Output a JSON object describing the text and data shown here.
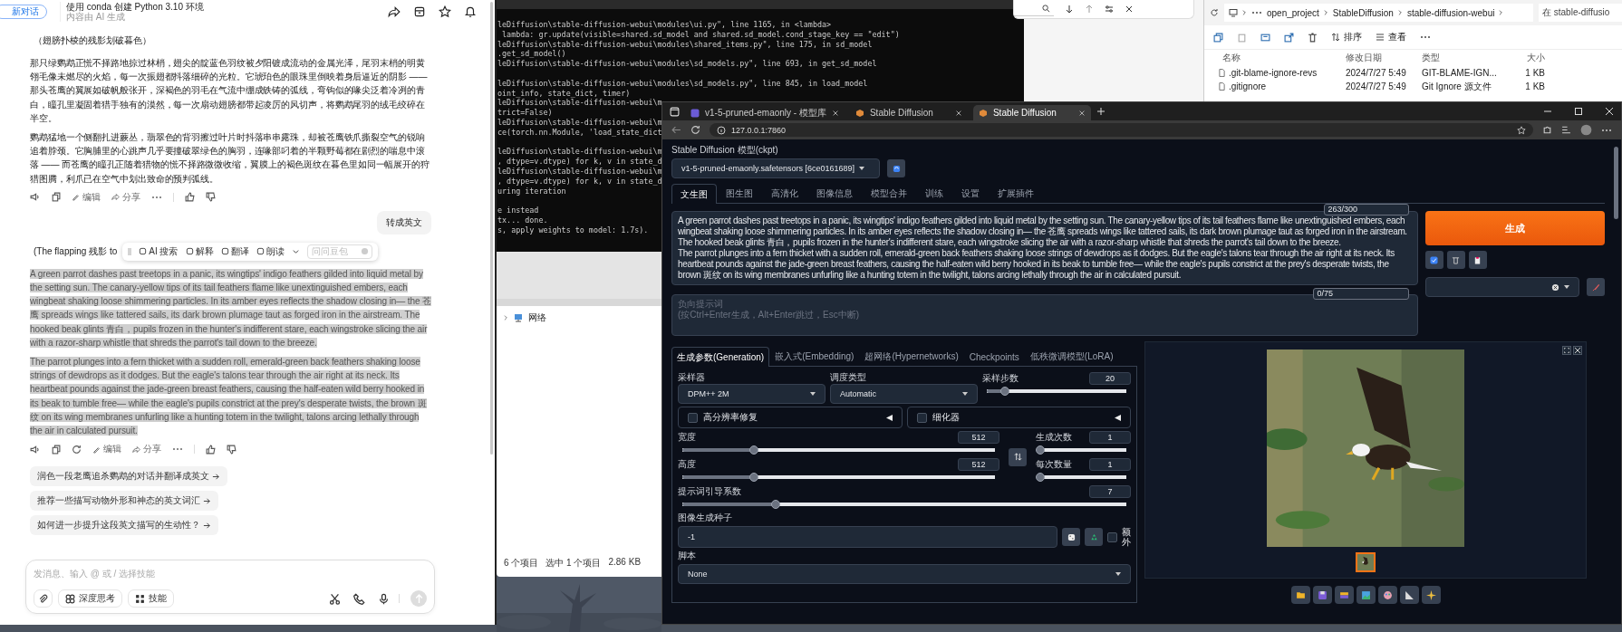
{
  "chat_window": {
    "new_chat_button": "新对话",
    "title": "使用 conda 创建 Python 3.10 环境",
    "subtitle": "内容由 AI 生成",
    "messages": [
      {
        "kind": "assistant",
        "heading": "（翅膀扑棱的残影划破暮色）",
        "text_selected": false,
        "regenerate": false,
        "paragraphs": [
          "那只绿鹦鹉正慌不择路地掠过林梢，翅尖的靛蓝色羽纹被夕阳镀成流动的金属光泽，尾羽末梢的明黄翎毛像未燃尽的火焰，每一次振翅都抖落细碎的光粒。它琥珀色的眼珠里倒映着身后逼近的阴影 —— 那头苍鹰的翼展如破帆般张开，深褐色的羽毛在气流中绷成铁铸的弧线，弯钩似的喙尖泛着冷冽的青白，瞳孔里凝固着猎手独有的漠然，每一次扇动翅膀都带起凌厉的风切声，将鹦鹉尾羽的绒毛绞碎在半空。",
          "鹦鹉猛地一个侧翻扎进蕨丛，翡翠色的背羽擦过叶片时抖落串串露珠，却被苍鹰铁爪撕裂空气的锐响追着脖颈。它胸脯里的心跳声几乎要撞破翠绿色的胸羽，连喙部叼着的半颗野莓都在剧烈的喘息中滚落 —— 而苍鹰的瞳孔正随着猎物的慌不择路微微收缩，翼膜上的褐色斑纹在暮色里如同一幅展开的狩猎图腾，利爪已在空气中划出致命的预判弧线。"
        ],
        "actions": [
          "编辑",
          "分享"
        ]
      },
      {
        "kind": "user",
        "text": "转成英文"
      },
      {
        "kind": "assistant",
        "heading": "(The flapping 残影 to",
        "text_selected": true,
        "regenerate": true,
        "selection_toolbar": {
          "actions": [
            "AI 搜索",
            "解释",
            "翻译",
            "朗读"
          ],
          "ask_placeholder": "问问豆包"
        },
        "paragraphs": [
          "A green parrot dashes past treetops in a panic, its wingtips' indigo feathers gilded into liquid metal by the setting sun. The canary-yellow tips of its tail feathers flame like unextinguished embers, each wingbeat shaking loose shimmering particles. In its amber eyes reflects the shadow closing in— the 苍鹰 spreads wings like tattered sails, its dark brown plumage taut as forged iron in the airstream. The hooked beak glints 青白，pupils frozen in the hunter's indifferent stare, each wingstroke slicing the air with a razor-sharp whistle that shreds the parrot's tail down to the breeze.",
          "The parrot plunges into a fern thicket with a sudden roll, emerald-green back feathers shaking loose strings of dewdrops as it dodges. But the eagle's talons tear through the air right at its neck. Its heartbeat pounds against the jade-green breast feathers, causing the half-eaten wild berry hooked in its beak to tumble free— while the eagle's pupils constrict at the prey's desperate twists, the brown 斑纹 on its wing membranes unfurling like a hunting totem in the twilight, talons arcing lethally through the air in calculated pursuit."
        ],
        "actions": [
          "编辑",
          "分享"
        ]
      }
    ],
    "suggestions": [
      "润色一段老鹰追杀鹦鹉的对话并翻译成英文",
      "推荐一些描写动物外形和神态的英文词汇",
      "如何进一步提升这段英文描写的生动性？"
    ],
    "composer": {
      "placeholder": "发消息、输入 @ 或 / 选择技能",
      "buttons": [
        "深度思考",
        "技能"
      ]
    }
  },
  "terminal": {
    "blocks": [
      {
        "lines": [
          "leDiffusion\\stable-diffusion-webui\\modules\\ui.py\", line 1165, in <lambda>",
          " lambda: gr.update(visible=shared.sd_model and shared.sd_model.cond_stage_key == \"edit\")",
          "leDiffusion\\stable-diffusion-webui\\modules\\shared_items.py\", line 175, in sd_model",
          ".get_sd_model()",
          "leDiffusion\\stable-diffusion-webui\\modules\\sd_models.py\", line 693, in get_sd_model"
        ]
      },
      {
        "lines": [
          "leDiffusion\\stable-diffusion-webui\\modules\\sd_models.py\", line 845, in load_model",
          "oint_info, state_dict, timer)",
          "leDiffusion\\stable-diffusion-webui\\m",
          "trict=False)",
          "leDiffusion\\stable-diffusion-webui\\m",
          "ce(torch.nn.Module, 'load_state_dict"
        ]
      },
      {
        "lines": [
          "leDiffusion\\stable-diffusion-webui\\m",
          ", dtype=v.dtype) for k, v in state_d",
          "leDiffusion\\stable-diffusion-webui\\m",
          ", dtype=v.dtype) for k, v in state_d",
          "uring iteration"
        ]
      },
      {
        "lines": [
          "e instead",
          "tx... done.",
          "s, apply weights to model: 1.7s)."
        ]
      }
    ]
  },
  "explorer": {
    "breadcrumb": [
      "open_project",
      "StableDiffusion",
      "stable-diffusion-webui"
    ],
    "search_placeholder": "在 stable-diffusio",
    "toolbar": [
      "排序",
      "查看"
    ],
    "columns": [
      "名称",
      "修改日期",
      "类型",
      "大小"
    ],
    "rows": [
      [
        ".git-blame-ignore-revs",
        "2024/7/27 5:49",
        "GIT-BLAME-IGN...",
        "1 KB"
      ],
      [
        ".gitignore",
        "2024/7/27 5:49",
        "Git Ignore 源文件",
        "1 KB"
      ]
    ]
  },
  "explorer_pane": {
    "nav_items": [
      "网络"
    ],
    "status": [
      "6 个项目",
      "选中 1 个项目",
      "2.86 KB"
    ]
  },
  "browser": {
    "tabs": [
      {
        "title": "v1-5-pruned-emaonly - 模型库",
        "selected": false
      },
      {
        "title": "Stable Diffusion",
        "selected": false
      },
      {
        "title": "Stable Diffusion",
        "selected": true
      }
    ],
    "url": "127.0.0.1:7860",
    "page": {
      "model_label": "Stable Diffusion 模型(ckpt)",
      "model_value": "v1-5-pruned-emaonly.safetensors [6ce0161689]",
      "tabs": [
        {
          "label": "文生图",
          "selected": true
        },
        {
          "label": "图生图",
          "selected": false
        },
        {
          "label": "高清化",
          "selected": false
        },
        {
          "label": "图像信息",
          "selected": false
        },
        {
          "label": "模型合并",
          "selected": false
        },
        {
          "label": "训练",
          "selected": false
        },
        {
          "label": "设置",
          "selected": false
        },
        {
          "label": "扩展插件",
          "selected": false
        }
      ],
      "prompt": {
        "text": "A green parrot dashes past treetops in a panic, its wingtips' indigo feathers gilded into liquid metal by the setting sun. The canary-yellow tips of its tail feathers flame like unextinguished embers, each wingbeat shaking loose shimmering particles. In its amber eyes reflects the shadow closing in— the 苍鹰 spreads wings like tattered sails, its dark brown plumage taut as forged iron in the airstream. The hooked beak glints 青白，pupils frozen in the hunter's indifferent stare, each wingstroke slicing the air with a razor-sharp whistle that shreds the parrot's tail down to the breeze.\nThe parrot plunges into a fern thicket with a sudden roll, emerald-green back feathers shaking loose strings of dewdrops as it dodges. But the eagle's talons tear through the air right at its neck. Its heartbeat pounds against the jade-green breast feathers, causing the half-eaten wild berry hooked in its beak to tumble free— while the eagle's pupils constrict at the prey's desperate twists, the brown 斑纹 on its wing membranes unfurling like a hunting totem in the twilight, talons arcing lethally through the air in calculated pursuit.",
        "counter": "263/300"
      },
      "negative_prompt": {
        "placeholder": "负向提示词\n(按Ctrl+Enter生成，Alt+Enter跳过，Esc中断)",
        "counter": "0/75"
      },
      "generate_button": "生成",
      "subtabs": [
        {
          "label": "生成参数(Generation)",
          "selected": true
        },
        {
          "label": "嵌入式(Embedding)",
          "selected": false
        },
        {
          "label": "超网络(Hypernetworks)",
          "selected": false
        },
        {
          "label": "Checkpoints",
          "selected": false
        },
        {
          "label": "低秩微调模型(LoRA)",
          "selected": false
        }
      ],
      "sampler": {
        "label": "采样器",
        "value": "DPM++ 2M"
      },
      "scheduler": {
        "label": "调度类型",
        "value": "Automatic"
      },
      "steps": {
        "label": "采样步数",
        "value": "20",
        "level": 0.13
      },
      "accordions": [
        {
          "label": "高分辨率修复",
          "checked": false
        },
        {
          "label": "细化器",
          "checked": false
        }
      ],
      "width": {
        "label": "宽度",
        "value": "512",
        "level": 0.23
      },
      "height": {
        "label": "高度",
        "value": "512",
        "level": 0.23
      },
      "batch_count": {
        "label": "生成次数",
        "value": "1",
        "level": 0
      },
      "batch_size": {
        "label": "每次数量",
        "value": "1",
        "level": 0
      },
      "cfg_scale": {
        "label": "提示词引导系数",
        "value": "7",
        "level": 0.21
      },
      "seed": {
        "label": "图像生成种子",
        "value": "-1"
      },
      "extra": {
        "label": "额外",
        "checked": false
      },
      "script": {
        "label": "脚本",
        "value": "None"
      }
    }
  }
}
